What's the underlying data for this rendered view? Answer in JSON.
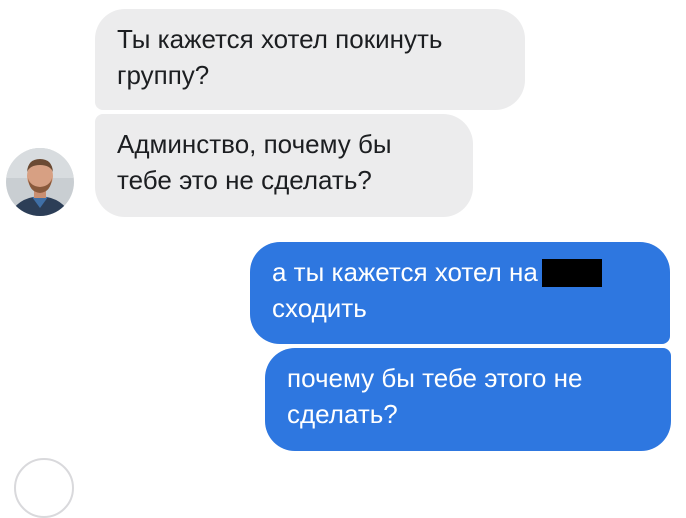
{
  "conversation": {
    "incoming": [
      {
        "lines": [
          "Ты кажется хотел покинуть",
          "группу?"
        ]
      },
      {
        "lines": [
          "Админство, почему бы",
          "тебе это не сделать?"
        ]
      }
    ],
    "outgoing": [
      {
        "lines": [
          "а ты кажется хотел на",
          "сходить"
        ],
        "redacted_word": true
      },
      {
        "lines": [
          "почему бы тебе этого не",
          "сделать?"
        ]
      }
    ]
  },
  "colors": {
    "incoming_bubble": "#ececed",
    "outgoing_bubble": "#2e77e0",
    "incoming_text": "#1c1e21",
    "outgoing_text": "#ffffff"
  },
  "icons": {
    "avatar": "contact-avatar-photo"
  }
}
